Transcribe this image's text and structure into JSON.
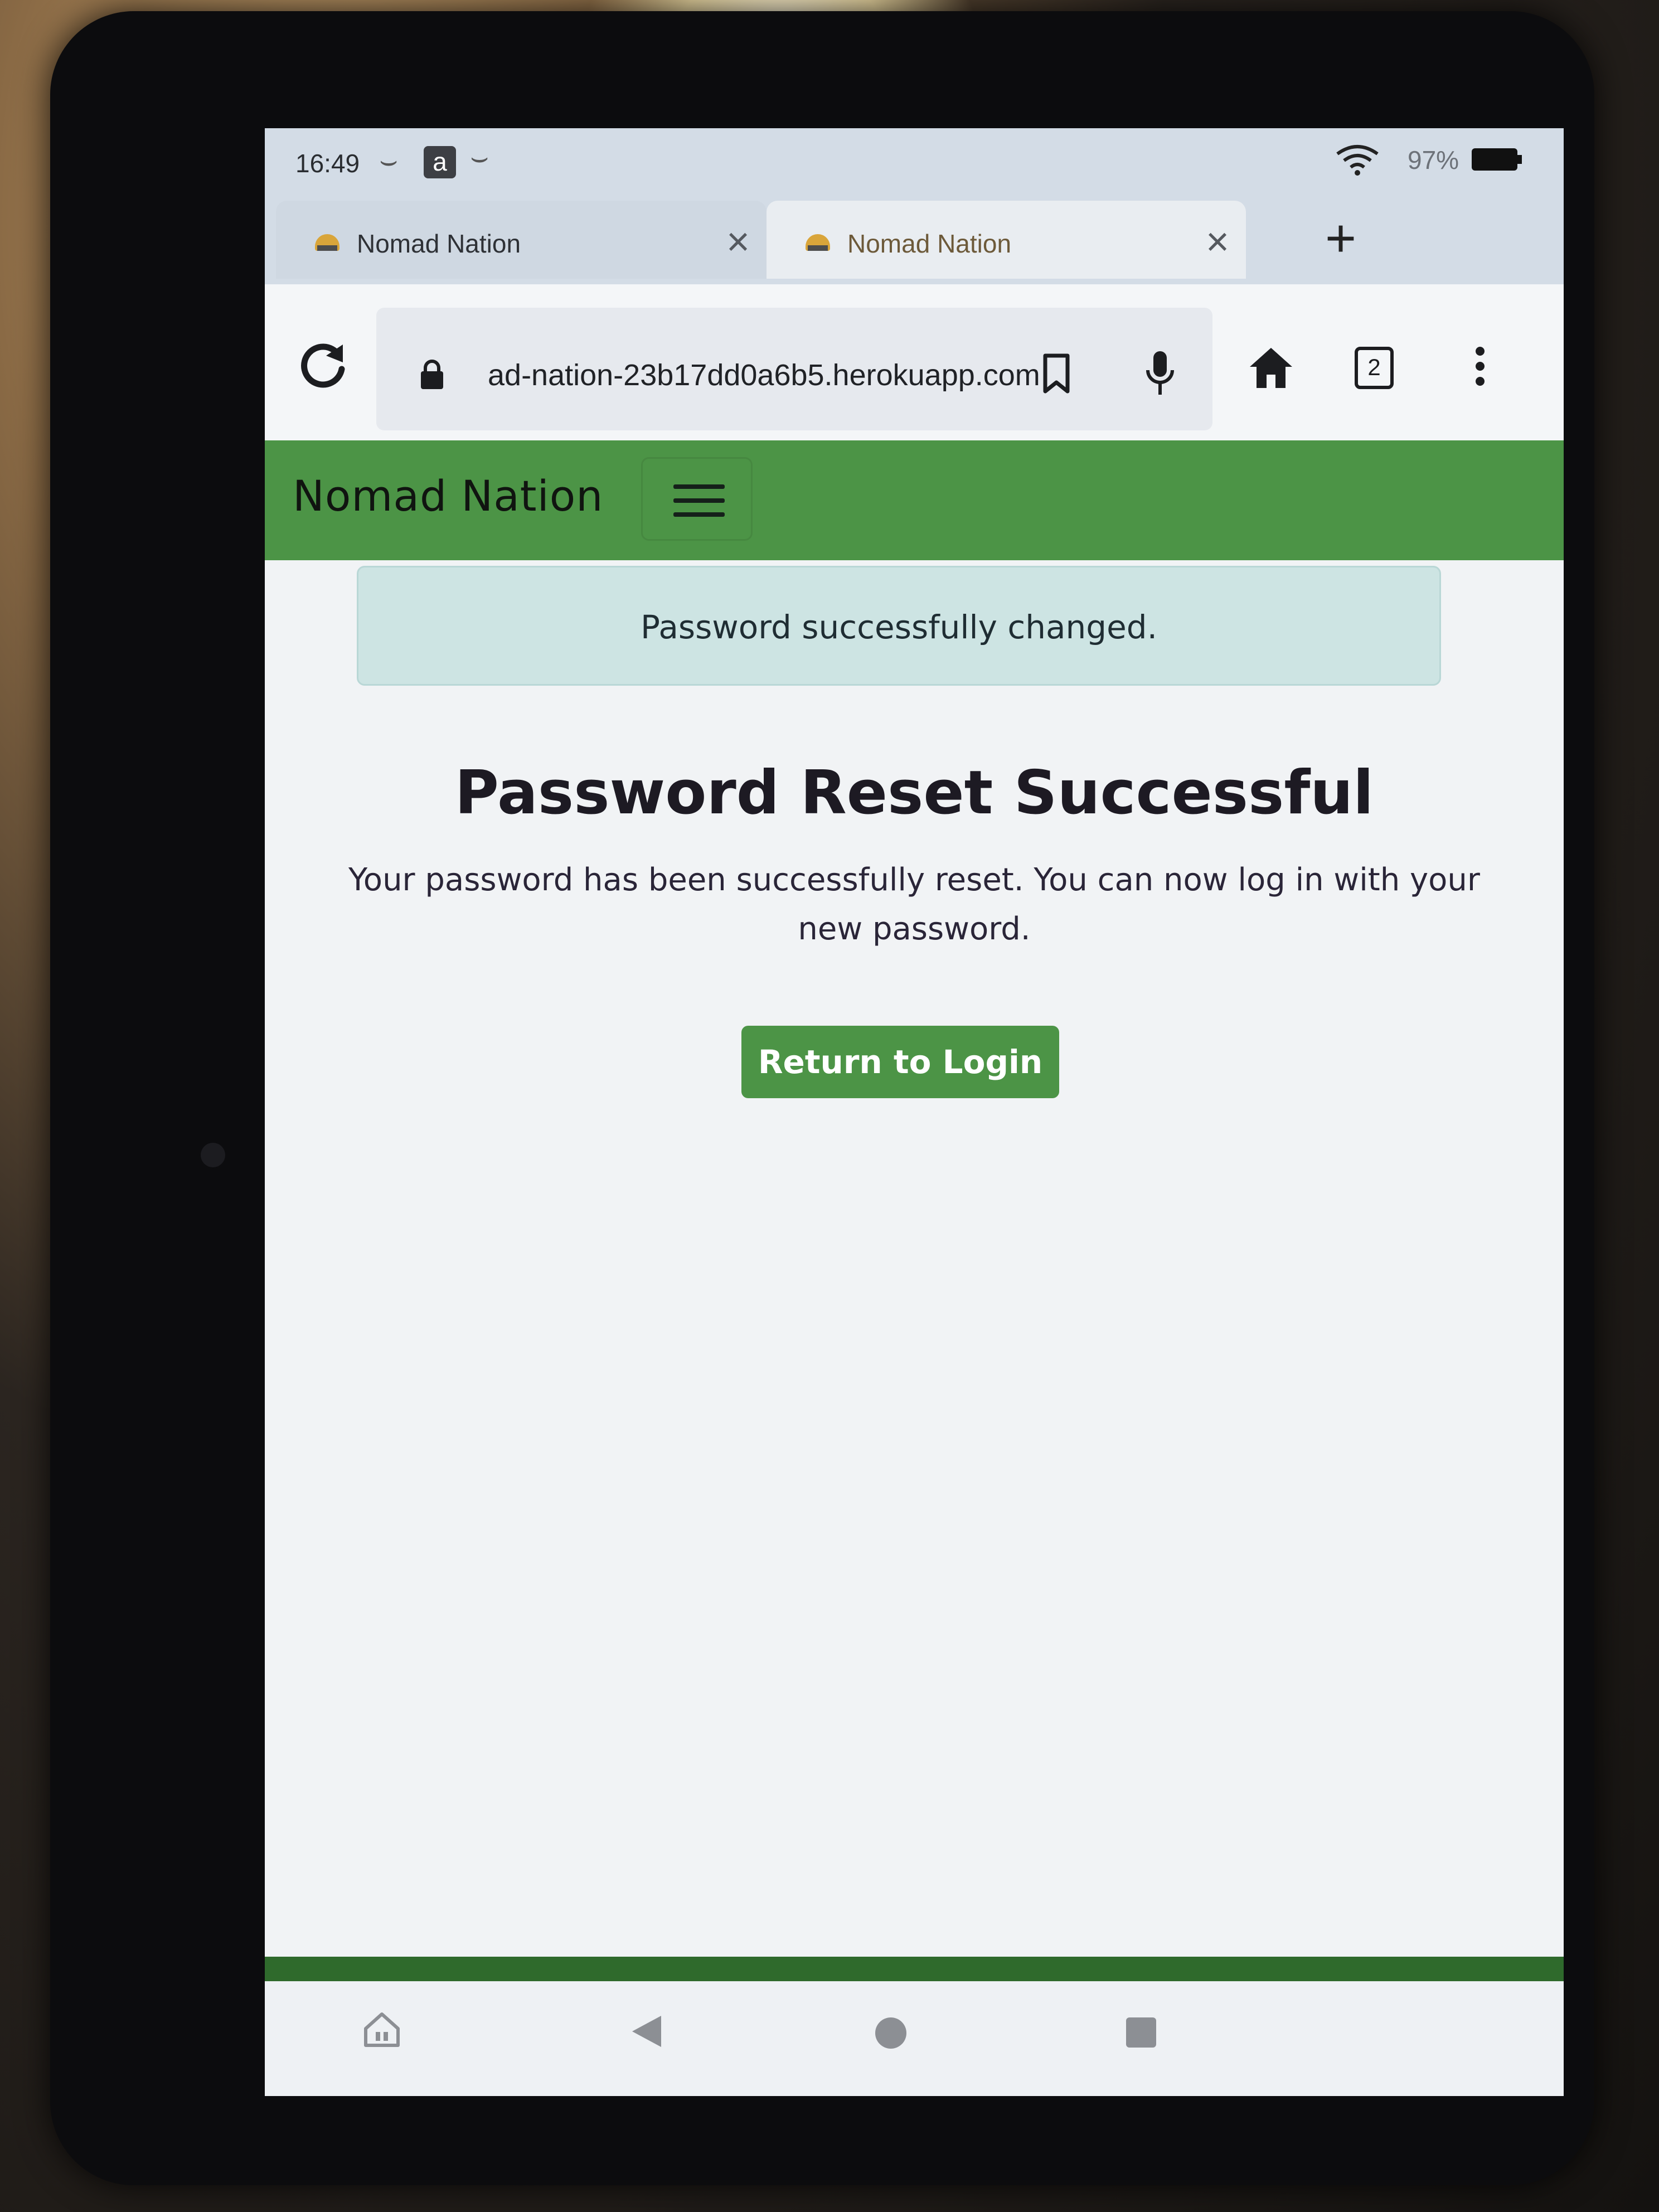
{
  "statusbar": {
    "time": "16:49",
    "amazon_badge": "a",
    "battery": "97%",
    "icons": [
      "amazon-icon",
      "wifi-icon",
      "battery-icon"
    ]
  },
  "tabs": [
    {
      "title": "Nomad Nation",
      "close": "×"
    },
    {
      "title": "Nomad Nation",
      "close": "×"
    }
  ],
  "new_tab_label": "+",
  "toolbar": {
    "url": "ad-nation-23b17dd0a6b5.herokuapp.com",
    "tabs_count": "2",
    "icons": [
      "reload-icon",
      "lock-icon",
      "bookmark-icon",
      "mic-icon",
      "home-icon",
      "menu-icon"
    ]
  },
  "navbar": {
    "brand": "Nomad Nation",
    "brand_color": "#4c9446"
  },
  "alert": {
    "message": "Password successfully changed.",
    "background": "#cde4e3"
  },
  "main": {
    "title": "Password Reset Successful",
    "message": "Your password has been successfully reset. You can now log in with your new password.",
    "button_label": "Return to Login",
    "button_color": "#4c9446"
  },
  "android_nav": {
    "icons": [
      "home-app-icon",
      "back-icon",
      "home-icon",
      "recents-icon"
    ]
  }
}
